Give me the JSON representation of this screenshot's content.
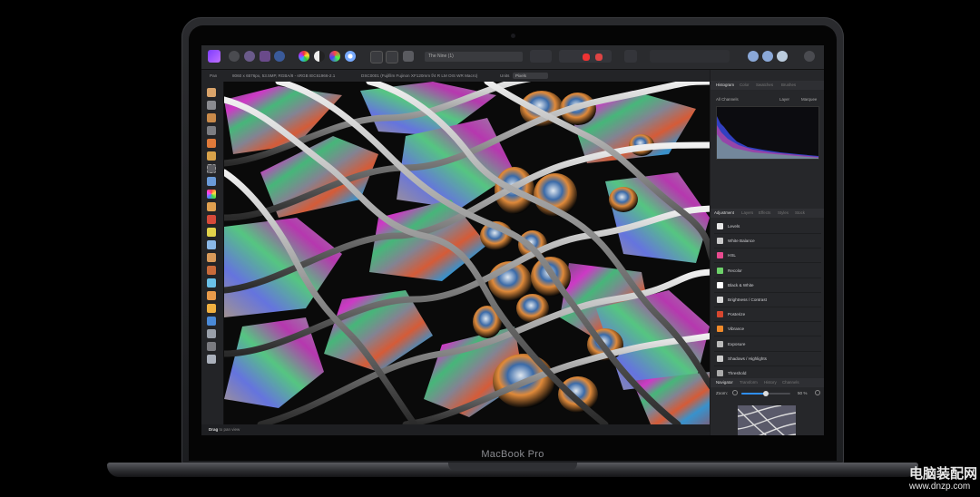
{
  "window": {
    "document_title": "The Nine (1)",
    "device_brand": "MacBook Pro"
  },
  "toolbar": {
    "icons": [
      "persona-icon",
      "gear-icon",
      "lasso-icon",
      "share-icon",
      "color-wheel-icon",
      "contrast-icon",
      "color-icon",
      "rgb-icon",
      "quick-mask-icon",
      "selection-icon",
      "assistant-icon",
      "layout-icon",
      "snap-icon",
      "view-icon",
      "account-icon"
    ]
  },
  "context_bar": {
    "pan_label": "Pan",
    "info_dims": "8060 x 6576px, 53.5MP, RGBA/8 - sRGB IEC61966-2.1",
    "info_camera": "DSC0001 (Fujifilm Fujinon XF120mm f/4 R LM OIS WR Macro)",
    "units_label": "Units",
    "units_value": "Pixels"
  },
  "tools": [
    "move-tool-icon",
    "select-tool-icon",
    "crop-tool-icon",
    "paint-brush-tool-icon",
    "selection-brush-tool-icon",
    "marquee-tool-icon",
    "color-picker-tool-icon",
    "fill-tool-icon",
    "gradient-tool-icon",
    "erase-tool-icon",
    "dodge-tool-icon",
    "clone-tool-icon",
    "healing-tool-icon",
    "blemish-tool-icon",
    "smudge-tool-icon",
    "sharpen-tool-icon",
    "pen-tool-icon",
    "text-tool-icon",
    "zoom-tool-icon",
    "hand-tool-icon"
  ],
  "status_bar": {
    "mode": "Drag",
    "hint": "to pan view"
  },
  "panels": {
    "top_tabs": [
      "Histogram",
      "Color",
      "Swatches",
      "Brushes"
    ],
    "histogram": {
      "channel": "All Channels",
      "layer_label": "Layer",
      "marquee_label": "Marquee"
    },
    "adjust_tabs": [
      "Adjustment",
      "Layers",
      "Effects",
      "Styles",
      "Stock"
    ],
    "adjustments": [
      {
        "label": "Levels",
        "icon": "levels-icon",
        "color": "#e8e8e8"
      },
      {
        "label": "White Balance",
        "icon": "white-balance-icon",
        "color": "#c9c9c9"
      },
      {
        "label": "HSL",
        "icon": "hsl-icon",
        "color": "#e84a8f"
      },
      {
        "label": "Recolor",
        "icon": "recolor-icon",
        "color": "#6dd16a"
      },
      {
        "label": "Black & White",
        "icon": "black-white-icon",
        "color": "#ffffff"
      },
      {
        "label": "Brightness / Contrast",
        "icon": "brightness-contrast-icon",
        "color": "#d8d8d8"
      },
      {
        "label": "Posterize",
        "icon": "posterize-icon",
        "color": "#d7472f"
      },
      {
        "label": "Vibrance",
        "icon": "vibrance-icon",
        "color": "#f08a2a"
      },
      {
        "label": "Exposure",
        "icon": "exposure-icon",
        "color": "#bbbbbb"
      },
      {
        "label": "Shadows / Highlights",
        "icon": "shadows-highlights-icon",
        "color": "#cccccc"
      },
      {
        "label": "Threshold",
        "icon": "threshold-icon",
        "color": "#aaaaaa"
      }
    ],
    "navigator_tabs": [
      "Navigator",
      "Transform",
      "History",
      "Channels"
    ],
    "zoom": {
      "label": "Zoom:",
      "value_text": "50 %",
      "fraction": 0.5
    }
  },
  "watermark": {
    "title": "电脑装配网",
    "url": "www.dnzp.com"
  },
  "colors": {
    "accent": "#2f8ff7",
    "toolbar_bg": "#2a2b2e",
    "panel_bg": "#26272a"
  }
}
